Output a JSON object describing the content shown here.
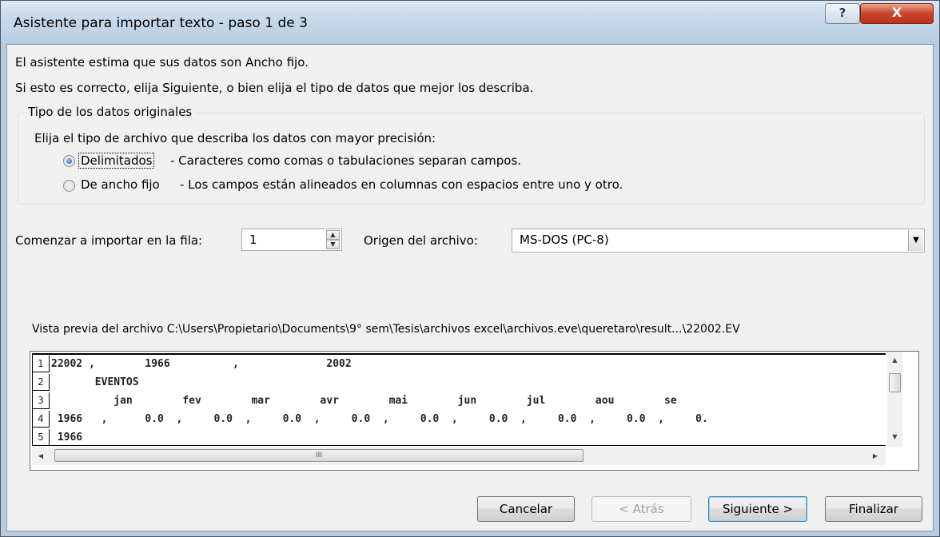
{
  "window": {
    "title": "Asistente para importar texto - paso 1 de 3",
    "help_label": "?",
    "close_label": "X"
  },
  "intro": {
    "line1": "El asistente estima que sus datos son Ancho fijo.",
    "line2": "Si esto es correcto, elija Siguiente, o bien elija el tipo de datos que mejor los describa."
  },
  "data_type": {
    "legend": "Tipo de los datos originales",
    "instruction": "Elija el tipo de archivo que describa los datos con mayor precisión:",
    "options": [
      {
        "label": "Delimitados",
        "description": "- Caracteres como comas o tabulaciones separan campos.",
        "checked": true
      },
      {
        "label": "De ancho fijo",
        "description": "- Los campos están alineados en columnas con espacios entre uno y otro.",
        "checked": false
      }
    ]
  },
  "start_row": {
    "label": "Comenzar a importar en la fila:",
    "value": "1"
  },
  "file_origin": {
    "label": "Origen del archivo:",
    "value": "MS-DOS (PC-8)"
  },
  "preview": {
    "label": "Vista previa del archivo C:\\Users\\Propietario\\Documents\\9° sem\\Tesis\\archivos excel\\archivos.eve\\queretaro\\result...\\22002.EV",
    "rows": [
      {
        "num": "1",
        "text": "22002 ,        1966          ,              2002"
      },
      {
        "num": "2",
        "text": "       EVENTOS"
      },
      {
        "num": "3",
        "text": "          jan        fev        mar        avr        mai        jun        jul        aou        se"
      },
      {
        "num": "4",
        "text": " 1966   ,      0.0  ,     0.0  ,     0.0  ,     0.0  ,     0.0  ,     0.0  ,     0.0  ,     0.0  ,     0."
      },
      {
        "num": "5",
        "text": " 1966"
      }
    ],
    "hscroll_grip": "III"
  },
  "buttons": {
    "cancel": "Cancelar",
    "back": "< Atrás",
    "next": "Siguiente >",
    "finish": "Finalizar"
  }
}
